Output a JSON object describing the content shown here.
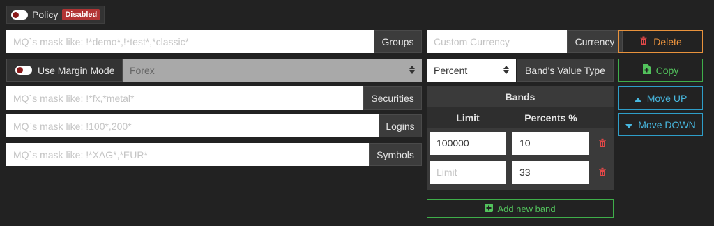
{
  "policy": {
    "label": "Policy",
    "status_badge": "Disabled"
  },
  "groups": {
    "placeholder": "MQ`s mask like: !*demo*,!*test*,*classic*",
    "addon": "Groups"
  },
  "currency": {
    "placeholder": "Custom Currency",
    "addon": "Currency"
  },
  "margin": {
    "label": "Use Margin Mode",
    "selected": "Forex"
  },
  "band_value_type": {
    "selected": "Percent",
    "addon": "Band's Value Type"
  },
  "securities": {
    "placeholder": "MQ`s mask like: !*fx,*metal*",
    "addon": "Securities"
  },
  "logins": {
    "placeholder": "MQ`s mask like: !100*,200*",
    "addon": "Logins"
  },
  "symbols": {
    "placeholder": "MQ`s mask like: !*XAG*,*EUR*",
    "addon": "Symbols"
  },
  "bands": {
    "title": "Bands",
    "col_limit": "Limit",
    "col_percents": "Percents %",
    "limit_placeholder": "Limit",
    "rows": [
      {
        "limit": "100000",
        "percent": "10"
      },
      {
        "limit": "",
        "percent": "33"
      }
    ],
    "add_label": "Add new band"
  },
  "actions": {
    "delete": "Delete",
    "copy": "Copy",
    "move_up": "Move UP",
    "move_down": "Move DOWN"
  },
  "colors": {
    "delete": "#f0963e",
    "copy": "#52c25c",
    "move": "#48b8e0",
    "trash": "#e04848",
    "badge": "#b23434"
  }
}
